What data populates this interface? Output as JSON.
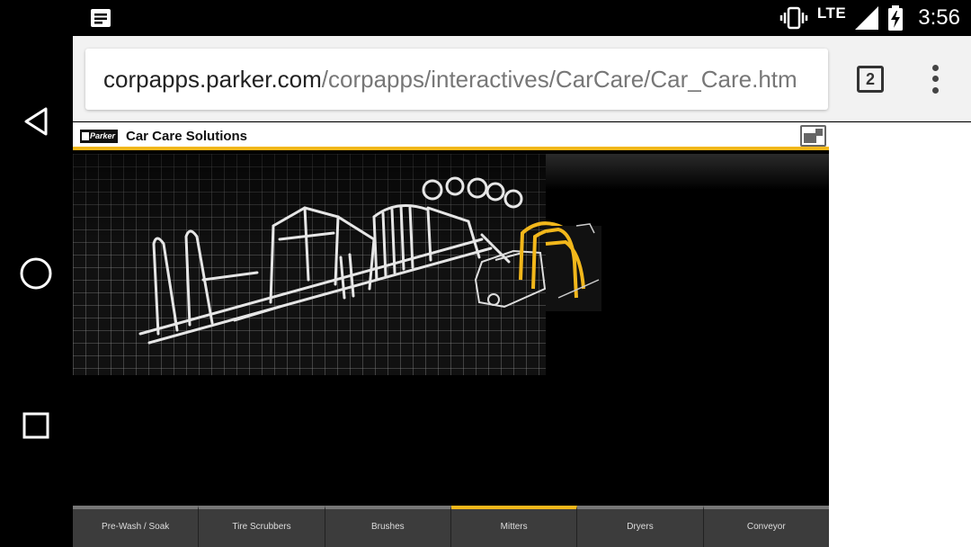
{
  "status_bar": {
    "network": "LTE",
    "time": "3:56",
    "icons": [
      "notification-icon",
      "vibrate-icon",
      "signal-icon",
      "battery-charging-icon"
    ]
  },
  "nav_bar": {
    "icons": [
      "back-icon",
      "home-icon",
      "recents-icon"
    ]
  },
  "browser": {
    "url_host": "corpapps.parker.com",
    "url_path": "/corpapps/interactives/CarCare/Car_Care.htm",
    "tab_count": "2",
    "menu_icon": "overflow-menu-icon"
  },
  "app": {
    "logo_text": "Parker",
    "title": "Car Care Solutions",
    "accent_color": "#f2b71b",
    "expand_icon": "expand-icon",
    "tabs": [
      {
        "label": "Pre-Wash / Soak",
        "active": false
      },
      {
        "label": "Tire Scrubbers",
        "active": false
      },
      {
        "label": "Brushes",
        "active": false
      },
      {
        "label": "Mitters",
        "active": true
      },
      {
        "label": "Dryers",
        "active": false
      },
      {
        "label": "Conveyor",
        "active": false
      }
    ]
  }
}
